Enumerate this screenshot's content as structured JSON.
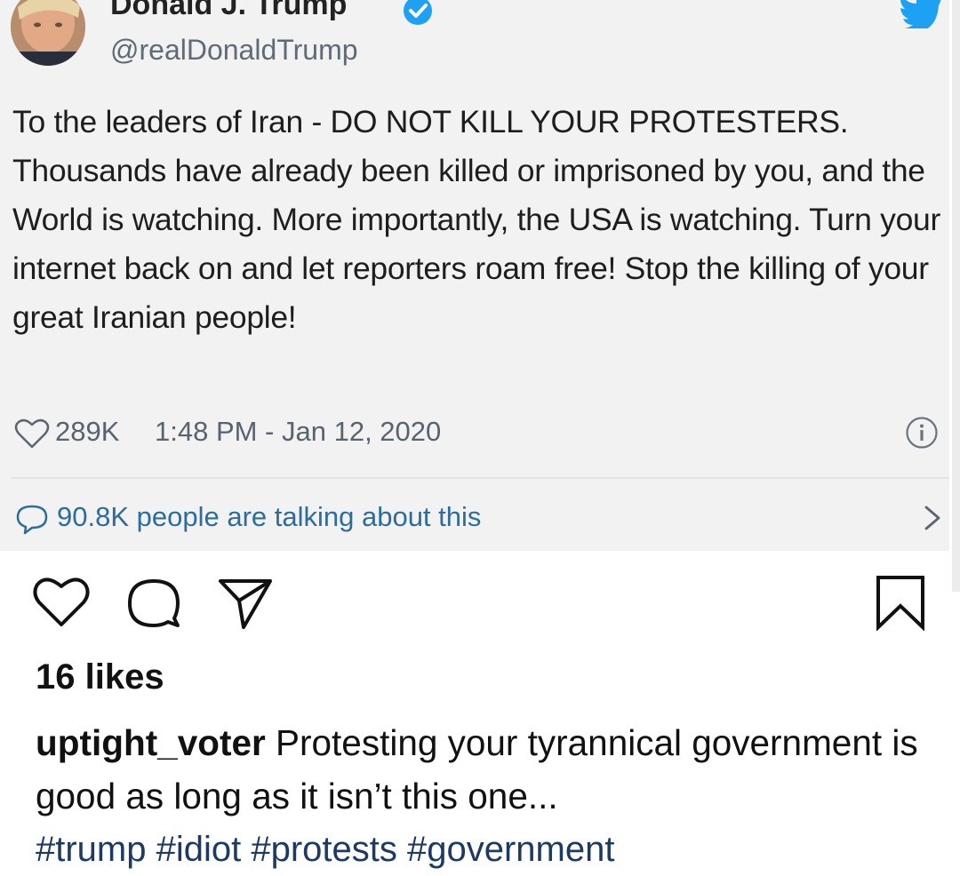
{
  "tweet": {
    "display_name": "Donald J. Trump",
    "handle": "@realDonaldTrump",
    "text": "To the leaders of Iran - DO NOT KILL YOUR PROTESTERS. Thousands have already been killed or imprisoned by you, and the World is watching. More importantly, the USA is watching. Turn your internet back on and let reporters roam free! Stop the killing of your great Iranian people!",
    "likes": "289K",
    "timestamp": "1:48 PM - Jan 12, 2020",
    "talking": "90.8K people are talking about this",
    "icons": [
      "avatar",
      "verified-badge-icon",
      "twitter-bird-icon",
      "heart-icon",
      "info-icon",
      "speech-bubble-icon",
      "chevron-right-icon"
    ],
    "colors": {
      "link": "#2b6d9c",
      "verified": "#1da1f2",
      "background": "#f2f2f2"
    }
  },
  "post": {
    "likes": "16 likes",
    "username": "uptight_voter",
    "caption": "Protesting your tyrannical government is good as long as it isn’t this one...",
    "hashtags": "#trump #idiot #protests #government",
    "icons": [
      "like-icon",
      "comment-icon",
      "share-icon",
      "bookmark-icon"
    ]
  }
}
